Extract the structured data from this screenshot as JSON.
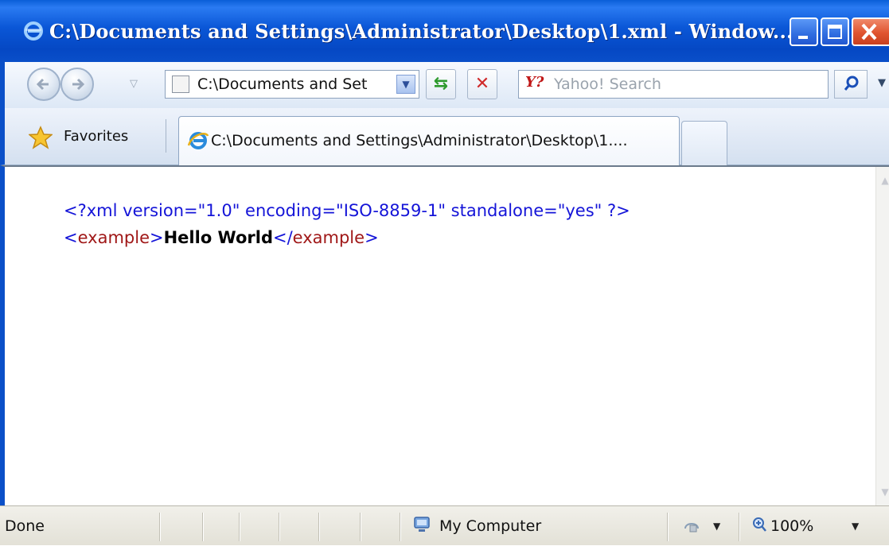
{
  "window": {
    "title": "C:\\Documents and Settings\\Administrator\\Desktop\\1.xml - Window...",
    "accent_color": "#0a4fc9"
  },
  "nav": {
    "address_value": "C:\\Documents and Set",
    "search_placeholder": "Yahoo! Search",
    "search_logo": "Y?",
    "back_icon": "back-arrow-icon",
    "forward_icon": "forward-arrow-icon",
    "refresh_icon": "refresh-icon",
    "stop_icon": "stop-icon"
  },
  "tabs": {
    "favorites_label": "Favorites",
    "active_tab_title": "C:\\Documents and Settings\\Administrator\\Desktop\\1...."
  },
  "document": {
    "declaration": "<?xml version=\"1.0\" encoding=\"ISO-8859-1\" standalone=\"yes\" ?>",
    "open_lt": "<",
    "open_tag": "example",
    "open_gt": ">",
    "text": "Hello World",
    "close_lt": "</",
    "close_tag": "example",
    "close_gt": ">"
  },
  "status": {
    "state": "Done",
    "zone": "My Computer",
    "zoom": "100%"
  }
}
